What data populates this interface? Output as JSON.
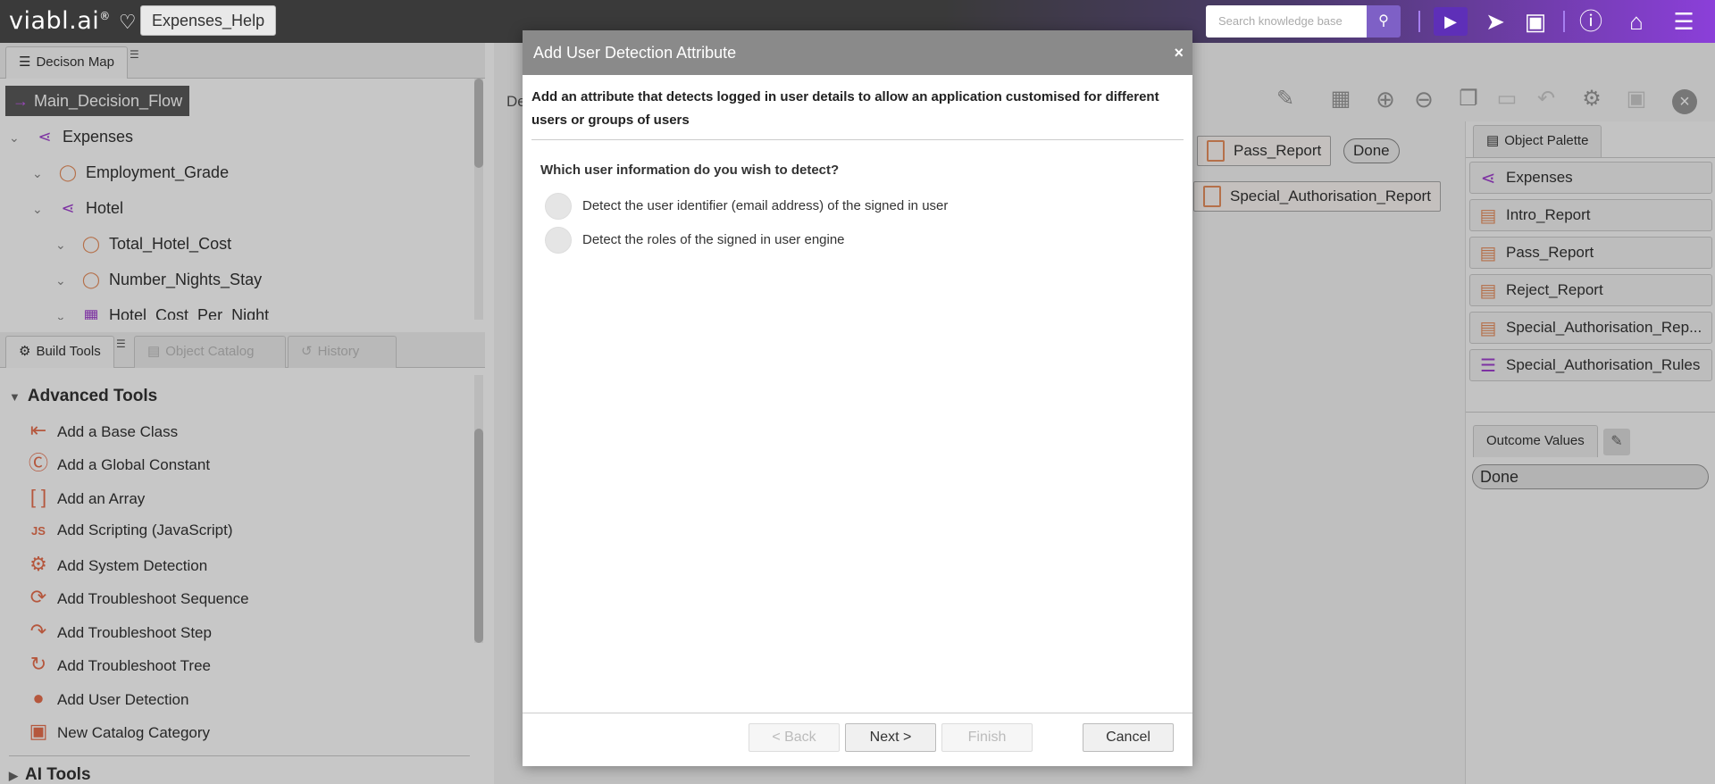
{
  "app": {
    "logo": "viabl.ai",
    "logo_mark": "®",
    "project_name": "Expenses_Help"
  },
  "header": {
    "search_placeholder": "Search knowledge base",
    "icons": [
      "search-icon",
      "play-icon",
      "rocket-icon",
      "save-icon",
      "help-icon",
      "home-icon",
      "menu-icon"
    ]
  },
  "decision_map": {
    "tab_label": "Decison Map",
    "root": "Main_Decision_Flow",
    "items": [
      {
        "label": "Expenses",
        "icon": "flow-icon"
      },
      {
        "label": "Employment_Grade",
        "icon": "question-icon"
      },
      {
        "label": "Hotel",
        "icon": "flow-icon"
      },
      {
        "label": "Total_Hotel_Cost",
        "icon": "question-icon"
      },
      {
        "label": "Number_Nights_Stay",
        "icon": "question-icon"
      },
      {
        "label": "Hotel_Cost_Per_Night",
        "icon": "table-icon"
      }
    ]
  },
  "build_tabs": {
    "build_tools": "Build Tools",
    "object_catalog": "Object Catalog",
    "history": "History"
  },
  "advanced_tools": {
    "title": "Advanced Tools",
    "items": [
      "Add a Base Class",
      "Add a Global Constant",
      "Add an Array",
      "Add Scripting (JavaScript)",
      "Add System Detection",
      "Add Troubleshoot Sequence",
      "Add Troubleshoot Step",
      "Add Troubleshoot Tree",
      "Add User Detection",
      "New Catalog Category"
    ]
  },
  "ai_tools": {
    "title": "AI Tools"
  },
  "canvas": {
    "tab_fragment": "De",
    "nodes": {
      "pass_report": "Pass_Report",
      "done": "Done",
      "special_report": "Special_Authorisation_Report"
    }
  },
  "palette": {
    "title": "Object Palette",
    "items": [
      "Expenses",
      "Intro_Report",
      "Pass_Report",
      "Reject_Report",
      "Special_Authorisation_Rep...",
      "Special_Authorisation_Rules"
    ]
  },
  "outcome_values": {
    "title": "Outcome Values",
    "values": [
      "Done"
    ]
  },
  "modal": {
    "title": "Add User Detection Attribute",
    "close": "×",
    "description": "Add an attribute that detects logged in user details to allow an application customised for different users or groups of users",
    "question": "Which user information do you wish to detect?",
    "options": [
      "Detect the user identifier (email address) of the signed in user",
      "Detect the roles of the signed in user engine"
    ],
    "buttons": {
      "back": "< Back",
      "next": "Next >",
      "finish": "Finish",
      "cancel": "Cancel"
    }
  }
}
